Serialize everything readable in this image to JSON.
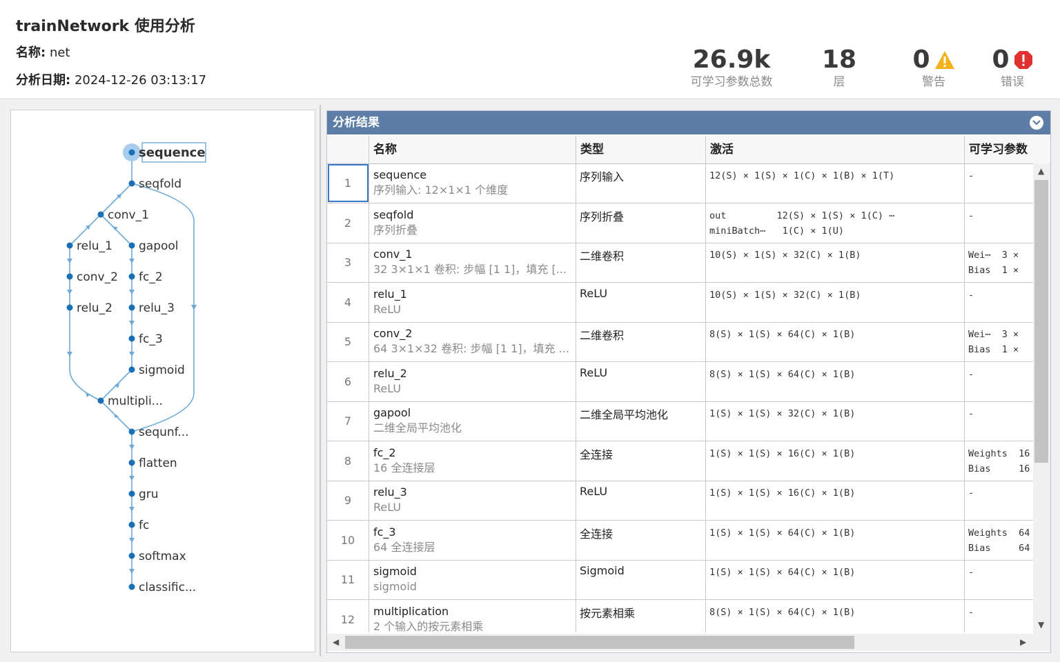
{
  "header": {
    "title": "trainNetwork 使用分析",
    "name_label": "名称:",
    "name_value": "net",
    "date_label": "分析日期:",
    "date_value": "2024-12-26 03:13:17"
  },
  "stats": {
    "params_value": "26.9k",
    "params_label": "可学习参数总数",
    "layers_value": "18",
    "layers_label": "层",
    "warnings_value": "0",
    "warnings_label": "警告",
    "errors_value": "0",
    "errors_label": "错误"
  },
  "graph": {
    "nodes": [
      "sequence",
      "seqfold",
      "conv_1",
      "relu_1",
      "gapool",
      "conv_2",
      "fc_2",
      "relu_2",
      "relu_3",
      "fc_3",
      "sigmoid",
      "multipli...",
      "sequnf...",
      "flatten",
      "gru",
      "fc",
      "softmax",
      "classific..."
    ]
  },
  "table": {
    "title": "分析结果",
    "headers": [
      "名称",
      "类型",
      "激活",
      "可学习参数"
    ],
    "rows": [
      {
        "idx": "1",
        "name": "sequence",
        "desc": "序列输入: 12×1×1 个维度",
        "type": "序列输入",
        "act1": "12(S) × 1(S) × 1(C) × 1(B) × 1(T)",
        "act2": "",
        "par1": "-",
        "par2": ""
      },
      {
        "idx": "2",
        "name": "seqfold",
        "desc": "序列折叠",
        "type": "序列折叠",
        "act1": "out         12(S) × 1(S) × 1(C) ⋯",
        "act2": "miniBatch⋯   1(C) × 1(U)",
        "par1": "-",
        "par2": ""
      },
      {
        "idx": "3",
        "name": "conv_1",
        "desc": "32 3×1×1 卷积: 步幅 [1 1]，填充 [...",
        "type": "二维卷积",
        "act1": "10(S) × 1(S) × 32(C) × 1(B)",
        "act2": "",
        "par1": "Wei⋯  3 ×",
        "par2": "Bias  1 ×"
      },
      {
        "idx": "4",
        "name": "relu_1",
        "desc": "ReLU",
        "type": "ReLU",
        "act1": "10(S) × 1(S) × 32(C) × 1(B)",
        "act2": "",
        "par1": "-",
        "par2": ""
      },
      {
        "idx": "5",
        "name": "conv_2",
        "desc": "64 3×1×32 卷积: 步幅 [1 1]，填充 ...",
        "type": "二维卷积",
        "act1": "8(S) × 1(S) × 64(C) × 1(B)",
        "act2": "",
        "par1": "Wei⋯  3 ×",
        "par2": "Bias  1 ×"
      },
      {
        "idx": "6",
        "name": "relu_2",
        "desc": "ReLU",
        "type": "ReLU",
        "act1": "8(S) × 1(S) × 64(C) × 1(B)",
        "act2": "",
        "par1": "-",
        "par2": ""
      },
      {
        "idx": "7",
        "name": "gapool",
        "desc": "二维全局平均池化",
        "type": "二维全局平均池化",
        "act1": "1(S) × 1(S) × 32(C) × 1(B)",
        "act2": "",
        "par1": "-",
        "par2": ""
      },
      {
        "idx": "8",
        "name": "fc_2",
        "desc": "16 全连接层",
        "type": "全连接",
        "act1": "1(S) × 1(S) × 16(C) × 1(B)",
        "act2": "",
        "par1": "Weights  16",
        "par2": "Bias     16"
      },
      {
        "idx": "9",
        "name": "relu_3",
        "desc": "ReLU",
        "type": "ReLU",
        "act1": "1(S) × 1(S) × 16(C) × 1(B)",
        "act2": "",
        "par1": "-",
        "par2": ""
      },
      {
        "idx": "10",
        "name": "fc_3",
        "desc": "64 全连接层",
        "type": "全连接",
        "act1": "1(S) × 1(S) × 64(C) × 1(B)",
        "act2": "",
        "par1": "Weights  64",
        "par2": "Bias     64"
      },
      {
        "idx": "11",
        "name": "sigmoid",
        "desc": "sigmoid",
        "type": "Sigmoid",
        "act1": "1(S) × 1(S) × 64(C) × 1(B)",
        "act2": "",
        "par1": "-",
        "par2": ""
      },
      {
        "idx": "12",
        "name": "multiplication",
        "desc": "2 个输入的按元素相乘",
        "type": "按元素相乘",
        "act1": "8(S) × 1(S) × 64(C) × 1(B)",
        "act2": "",
        "par1": "-",
        "par2": ""
      }
    ]
  },
  "colors": {
    "title_bar": "#5d7da6",
    "node": "#1a6fb5",
    "edge": "#6ea9d6",
    "warning": "#f2b21b",
    "error": "#e03131"
  }
}
